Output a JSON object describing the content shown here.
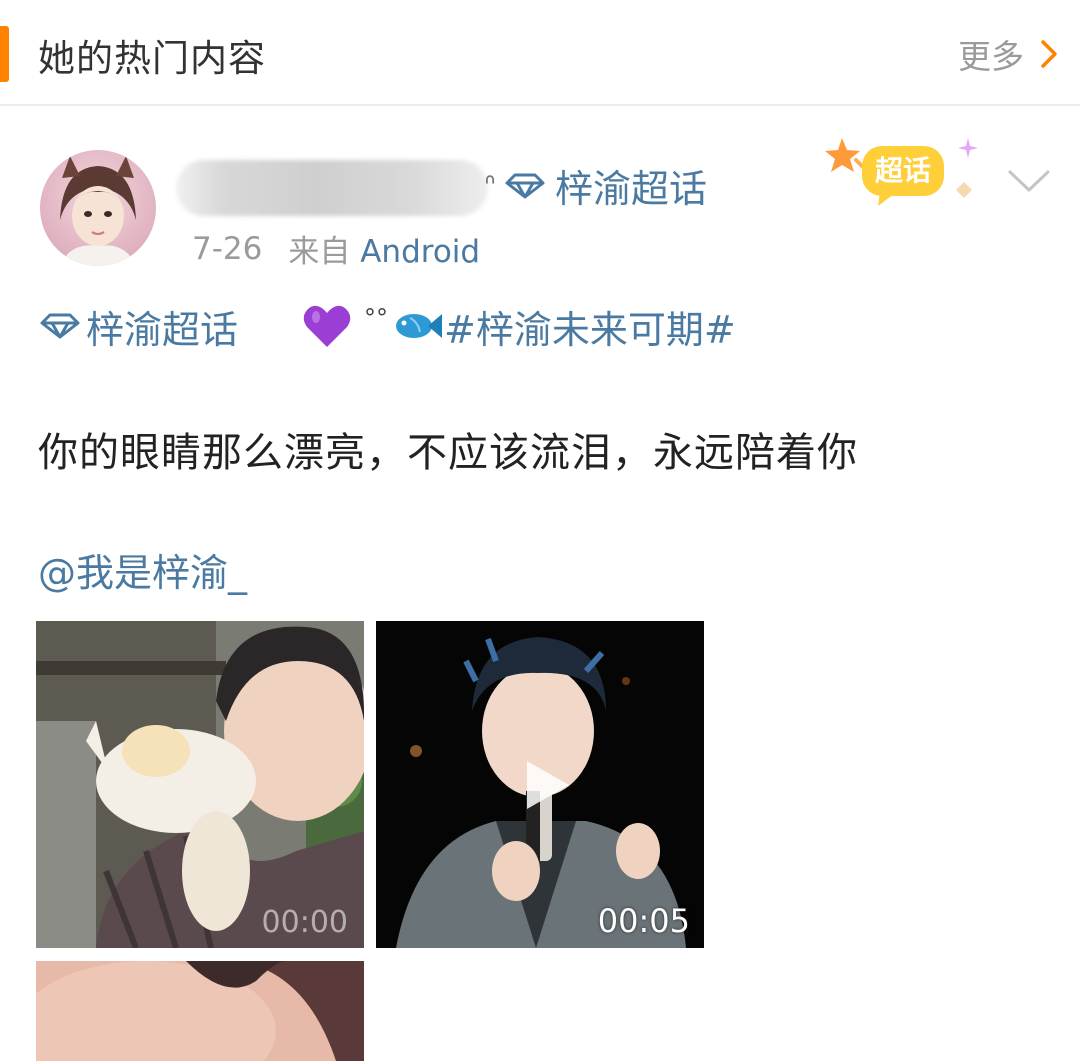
{
  "header": {
    "title": "她的热门内容",
    "more_label": "更多"
  },
  "post": {
    "author_tail": "ᐢ",
    "chaohua_label": "梓渝超话",
    "date": "7-26",
    "source_prefix": "来自",
    "source": "Android",
    "badge_label": "超话",
    "tag_line": {
      "chaohua_label": "梓渝超话",
      "bubbles": "°°",
      "hashtag": "#梓渝未来可期#"
    },
    "text": "你的眼睛那么漂亮，不应该流泪，永远陪着你",
    "mention": "@我是梓渝_",
    "media": [
      {
        "type": "photo",
        "description_icon": "photo-cat-icon",
        "duration_faded": "00:00"
      },
      {
        "type": "video",
        "duration": "00:05"
      },
      {
        "type": "photo"
      }
    ]
  },
  "colors": {
    "accent": "#ff8200",
    "link": "#4a7aa2",
    "text": "#222222",
    "meta": "#9b9b9b"
  }
}
